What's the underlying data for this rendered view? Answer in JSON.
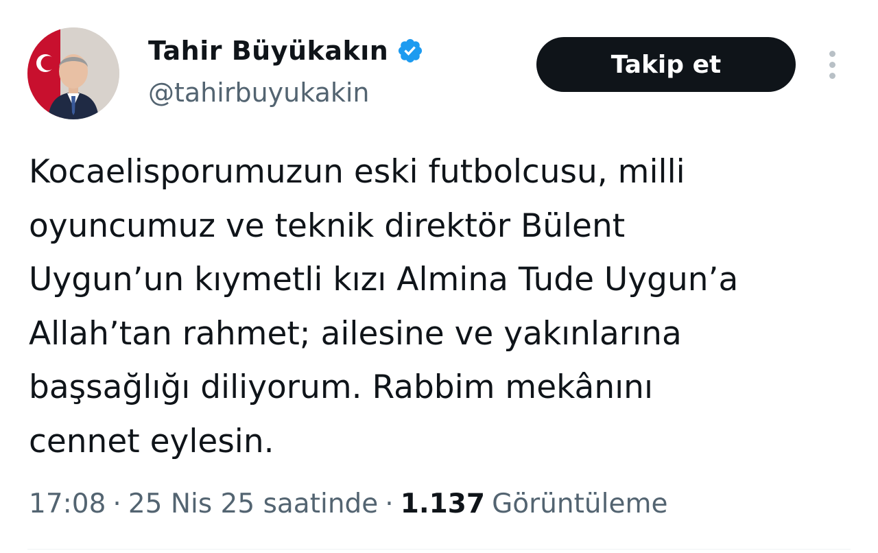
{
  "author": {
    "display_name": "Tahir Büyükakın",
    "handle": "@tahirbuyukakin",
    "verified": true
  },
  "actions": {
    "follow_label": "Takip et"
  },
  "tweet": {
    "text": "Kocaelisporumuzun eski futbolcusu, milli\noyuncumuz ve teknik direktör Bülent\nUygun’un kıymetli kızı Almina Tude Uygun’a\nAllah’tan rahmet; ailesine ve yakınlarına\nbaşsağlığı diliyorum. Rabbim mekânını\ncennet eylesin."
  },
  "meta": {
    "time": "17:08",
    "separator": "·",
    "date": "25 Nis 25 saatinde",
    "views_count": "1.137",
    "views_label": "Görüntüleme"
  },
  "icons": {
    "verified": "verified-badge-icon",
    "more": "more-vertical-icon"
  },
  "colors": {
    "primary_text": "#0f1419",
    "secondary_text": "#536471",
    "verified_blue": "#1d9bf0",
    "follow_button_bg": "#0f1419",
    "follow_button_text": "#ffffff"
  }
}
